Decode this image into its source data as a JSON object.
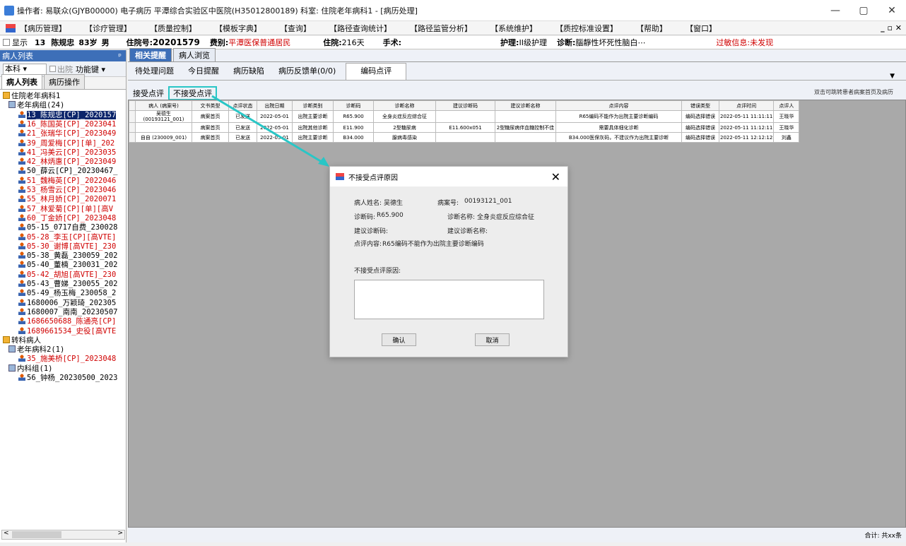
{
  "title": "操作者: 易联众(GJYB00000) 电子病历 平潭综合实验区中医院(H350128001​89) 科室: 住院老年病科1 - [病历处理]",
  "window_controls": {
    "min": "—",
    "max": "▢",
    "close": "✕"
  },
  "menu": [
    "【病历管理】",
    "【诊疗管理】",
    "【质量控制】",
    "【模板字典】",
    "【查询】",
    "【路径查询统计】",
    "【路径监管分析】",
    "【系统维护】",
    "【质控标准设置】",
    "【帮助】",
    "【窗口】"
  ],
  "menu_right": "_ ▫ ✕",
  "infobar": {
    "show": "显示",
    "bed": "13",
    "patient": "陈规忠",
    "age": "83岁",
    "sex": "男",
    "admission_label": "住院号:",
    "admission_no": "20201579",
    "fee_label": "费别:",
    "fee": "平潭医保普通居民",
    "stay_label": "住院:",
    "stay": "216天",
    "surgery_label": "手术:",
    "surgery": "",
    "nursing_label": "护理:",
    "nursing": "II级护理",
    "diag_label": "诊断:",
    "diag": "腦靜性坏死性脑白⋯",
    "allergy_label": "过敏信息:",
    "allergy": "未发现"
  },
  "leftpane": {
    "header": "病人列表",
    "pin": "ᵖ",
    "scope": "本科",
    "discharge": "出院",
    "func": "功能键",
    "tabs": [
      "病人列表",
      "病历操作"
    ]
  },
  "tree": [
    {
      "t": "住院老年病科1",
      "lvl": 0,
      "ico": "folder",
      "c": ""
    },
    {
      "t": "老年病组(24)",
      "lvl": 1,
      "ico": "grp",
      "c": ""
    },
    {
      "t": "13_陈规忠[CP]_2020157",
      "lvl": 2,
      "ico": "person",
      "c": "sel"
    },
    {
      "t": "16_陈国英[CP]_2023041",
      "lvl": 2,
      "ico": "person",
      "c": "redt"
    },
    {
      "t": "21_张瑞华[CP]_2023049",
      "lvl": 2,
      "ico": "person",
      "c": "redt"
    },
    {
      "t": "39_周爱梅[CP][单]_202",
      "lvl": 2,
      "ico": "person",
      "c": "redt"
    },
    {
      "t": "41_冯美云[CP]_2023035",
      "lvl": 2,
      "ico": "person",
      "c": "redt"
    },
    {
      "t": "42_林炳惠[CP]_2023049",
      "lvl": 2,
      "ico": "person",
      "c": "redt"
    },
    {
      "t": "50_薛云[CP]_20230467_",
      "lvl": 2,
      "ico": "person",
      "c": ""
    },
    {
      "t": "51_魏梅英[CP]_2022046",
      "lvl": 2,
      "ico": "person",
      "c": "redt"
    },
    {
      "t": "53_杨雪云[CP]_2023046",
      "lvl": 2,
      "ico": "person",
      "c": "redt"
    },
    {
      "t": "55_林月娇[CP]_2020071",
      "lvl": 2,
      "ico": "person",
      "c": "redt"
    },
    {
      "t": "57_林爱菊[CP][单][高V",
      "lvl": 2,
      "ico": "person",
      "c": "redt"
    },
    {
      "t": "60_丁金娇[CP]_2023048",
      "lvl": 2,
      "ico": "person",
      "c": "redt"
    },
    {
      "t": "05-15_0717自费_230028",
      "lvl": 2,
      "ico": "person",
      "c": ""
    },
    {
      "t": "05-28_李玉[CP][高VTE]",
      "lvl": 2,
      "ico": "person",
      "c": "redt"
    },
    {
      "t": "05-30_谢博[高VTE]_230",
      "lvl": 2,
      "ico": "person",
      "c": "redt"
    },
    {
      "t": "05-38_黄磊_230059_202",
      "lvl": 2,
      "ico": "person",
      "c": ""
    },
    {
      "t": "05-40_董楠_230031_202",
      "lvl": 2,
      "ico": "person",
      "c": ""
    },
    {
      "t": "05-42_胡旭[高VTE]_230",
      "lvl": 2,
      "ico": "person",
      "c": "redt"
    },
    {
      "t": "05-43_曹娣_230055_202",
      "lvl": 2,
      "ico": "person",
      "c": ""
    },
    {
      "t": "05-49_杨玉梅_230058_2",
      "lvl": 2,
      "ico": "person",
      "c": ""
    },
    {
      "t": "1680006_万颖琦_202305",
      "lvl": 2,
      "ico": "person",
      "c": ""
    },
    {
      "t": "1680007_南南_20230507",
      "lvl": 2,
      "ico": "person",
      "c": ""
    },
    {
      "t": "1686650688_陈通亮[CP]",
      "lvl": 2,
      "ico": "person",
      "c": "redt"
    },
    {
      "t": "1689661534_史役[高VTE",
      "lvl": 2,
      "ico": "person",
      "c": "redt"
    },
    {
      "t": "转科病人",
      "lvl": 0,
      "ico": "folder",
      "c": ""
    },
    {
      "t": "老年病科2(1)",
      "lvl": 1,
      "ico": "grp",
      "c": ""
    },
    {
      "t": "35_施美桥[CP]_2023048",
      "lvl": 2,
      "ico": "person",
      "c": "redt"
    },
    {
      "t": "内科组(1)",
      "lvl": 1,
      "ico": "grp",
      "c": ""
    },
    {
      "t": "56_钟杨_20230500_2023",
      "lvl": 2,
      "ico": "person",
      "c": ""
    }
  ],
  "main": {
    "tabs1": [
      "相关提醒",
      "病人浏览"
    ],
    "tabs2": [
      "待处理问题",
      "今日提醒",
      "病历缺陷",
      "病历反馈单(0/0)",
      "编码点评"
    ],
    "subtabs": [
      "接受点评",
      "不接受点评"
    ],
    "hint": "双击可跳转患者病案首页及病历",
    "footer": "合计: 共xx条"
  },
  "table": {
    "headers": [
      "病人 (病案号)",
      "文书类型",
      "点评状态",
      "出院日期",
      "诊断类别",
      "诊断码",
      "诊断名称",
      "建议诊断码",
      "建议诊断名称",
      "点评内容",
      "错误类型",
      "点评时间",
      "点评人"
    ],
    "rows": [
      [
        "吴德生 (00193121_001)",
        "病案首页",
        "已发送",
        "2022-05-01",
        "出院主要诊断",
        "R65.900",
        "全身炎症反应综合征",
        "",
        "",
        "R65编码不能作为出院主要诊断编码",
        "编码选择错误",
        "2022-05-11 11:11:11",
        "王晓华"
      ],
      [
        "",
        "病案首页",
        "已发送",
        "2022-05-01",
        "出院其他诊断",
        "E11.900",
        "2型糖尿病",
        "E11.600x051",
        "2型糖尿病伴血糖控制不佳",
        "需要具体细化诊断",
        "编码选择错误",
        "2022-05-11 11:12:11",
        "王晓华"
      ],
      [
        "自自 (230009_001)",
        "病案首页",
        "已发送",
        "2022-05-01",
        "出院主要诊断",
        "B34.000",
        "腺病毒感染",
        "",
        "",
        "B34.000医保灰码，不建议作为出院主要诊断",
        "编码选择错误",
        "2022-05-11 12:12:12",
        "刘鑫"
      ]
    ]
  },
  "dialog": {
    "title": "不接受点评原因",
    "close": "✕",
    "name_label": "病人姓名:",
    "name": "吴德生",
    "case_label": "病案号:",
    "case": "00193121_001",
    "code_label": "诊断码:",
    "code": "R65.900",
    "dname_label": "诊断名称:",
    "dname": "全身炎症反应综合征",
    "sug_code_label": "建议诊断码:",
    "sug_name_label": "建议诊断名称:",
    "content_label": "点评内容:",
    "content": "R65编码不能作为出院主要诊断编码",
    "reason_label": "不接受点评原因:",
    "reason_value": "",
    "ok": "确认",
    "cancel": "取消"
  }
}
